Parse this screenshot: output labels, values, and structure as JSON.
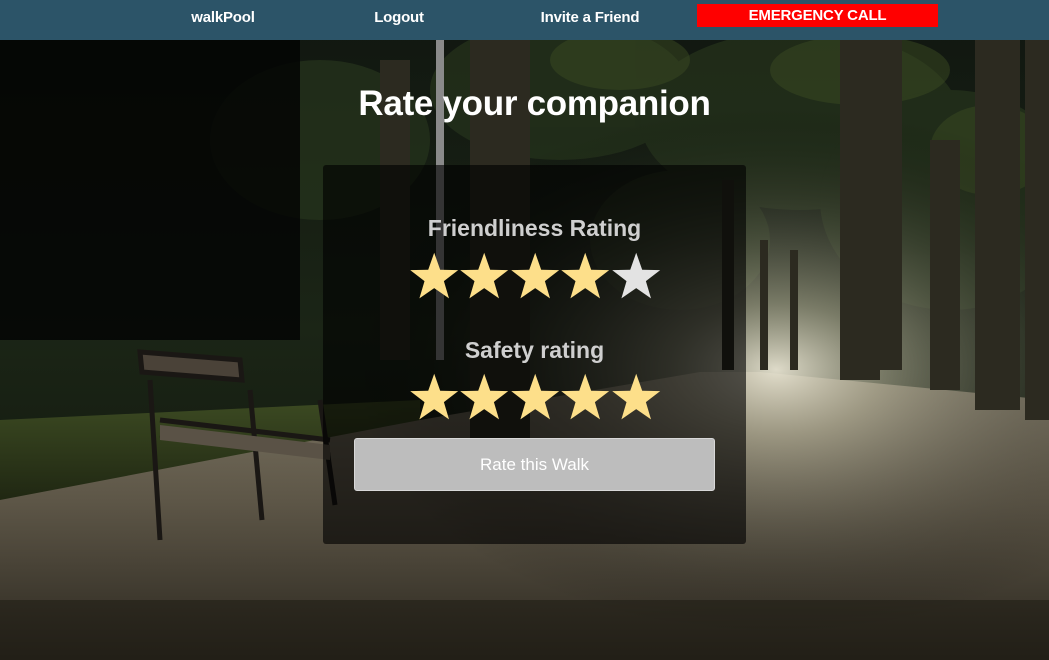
{
  "nav": {
    "brand": "walkPool",
    "logout": "Logout",
    "invite": "Invite a Friend",
    "emergency": "EMERGENCY CALL"
  },
  "title": "Rate your companion",
  "ratings": [
    {
      "label": "Friendliness Rating",
      "value": 4,
      "max": 5
    },
    {
      "label": "Safety rating",
      "value": 5,
      "max": 5
    }
  ],
  "submit_label": "Rate this Walk",
  "colors": {
    "nav_bg": "#2c5468",
    "emergency_bg": "#ff0000",
    "star_filled": "#fddf8a",
    "star_empty": "#e3e3e3",
    "button_bg": "#bdbdbd"
  },
  "icons": {
    "star": "star-icon",
    "background": "night-park-path-photo"
  }
}
